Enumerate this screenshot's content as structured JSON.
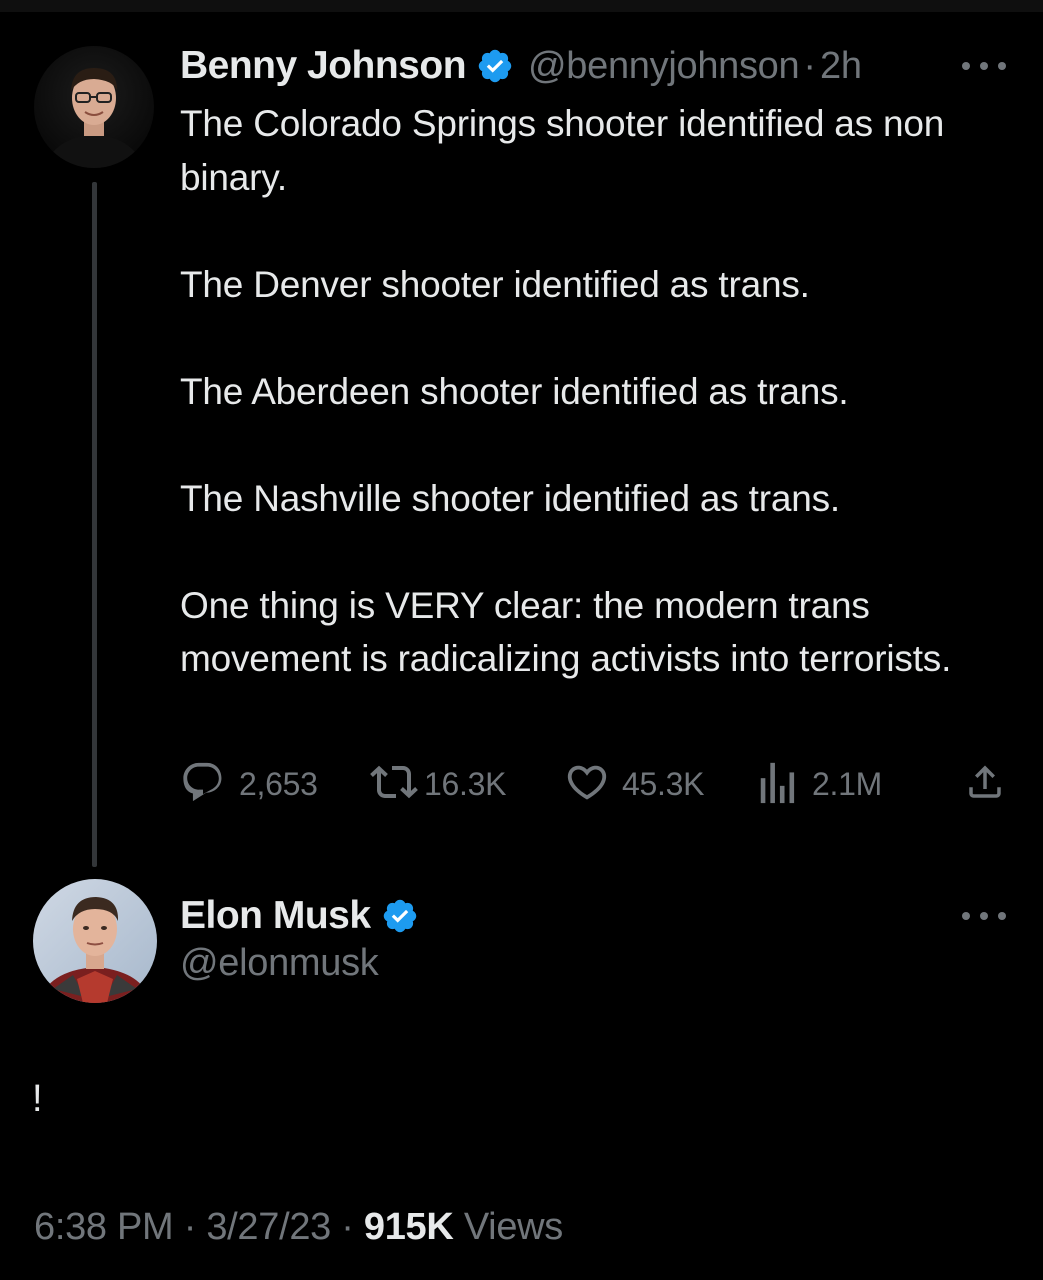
{
  "colors": {
    "background": "#000000",
    "text_primary": "#e7e9ea",
    "text_secondary": "#71767b",
    "verified_blue": "#1d9bf0",
    "thread_line": "#333639"
  },
  "original_tweet": {
    "author_name": "Benny Johnson",
    "verified": true,
    "handle": "@bennyjohnson",
    "separator": "·",
    "time": "2h",
    "paragraphs": [
      "The Colorado Springs shooter identified as non binary.",
      "The Denver shooter identified as trans.",
      "The Aberdeen shooter identified as trans.",
      "The Nashville shooter identified as trans.",
      "One thing is VERY clear: the modern trans movement is radicalizing activists into terrorists."
    ],
    "actions": {
      "replies": "2,653",
      "retweets": "16.3K",
      "likes": "45.3K",
      "views": "2.1M"
    },
    "icons": [
      "reply-icon",
      "retweet-icon",
      "like-icon",
      "views-icon",
      "share-icon",
      "more-icon",
      "verified-badge-icon"
    ]
  },
  "reply_tweet": {
    "author_name": "Elon Musk",
    "verified": true,
    "handle": "@elonmusk",
    "text": "!",
    "timestamp_time": "6:38 PM",
    "separator": "·",
    "timestamp_date": "3/27/23",
    "views_count": "915K",
    "views_label": "Views"
  }
}
